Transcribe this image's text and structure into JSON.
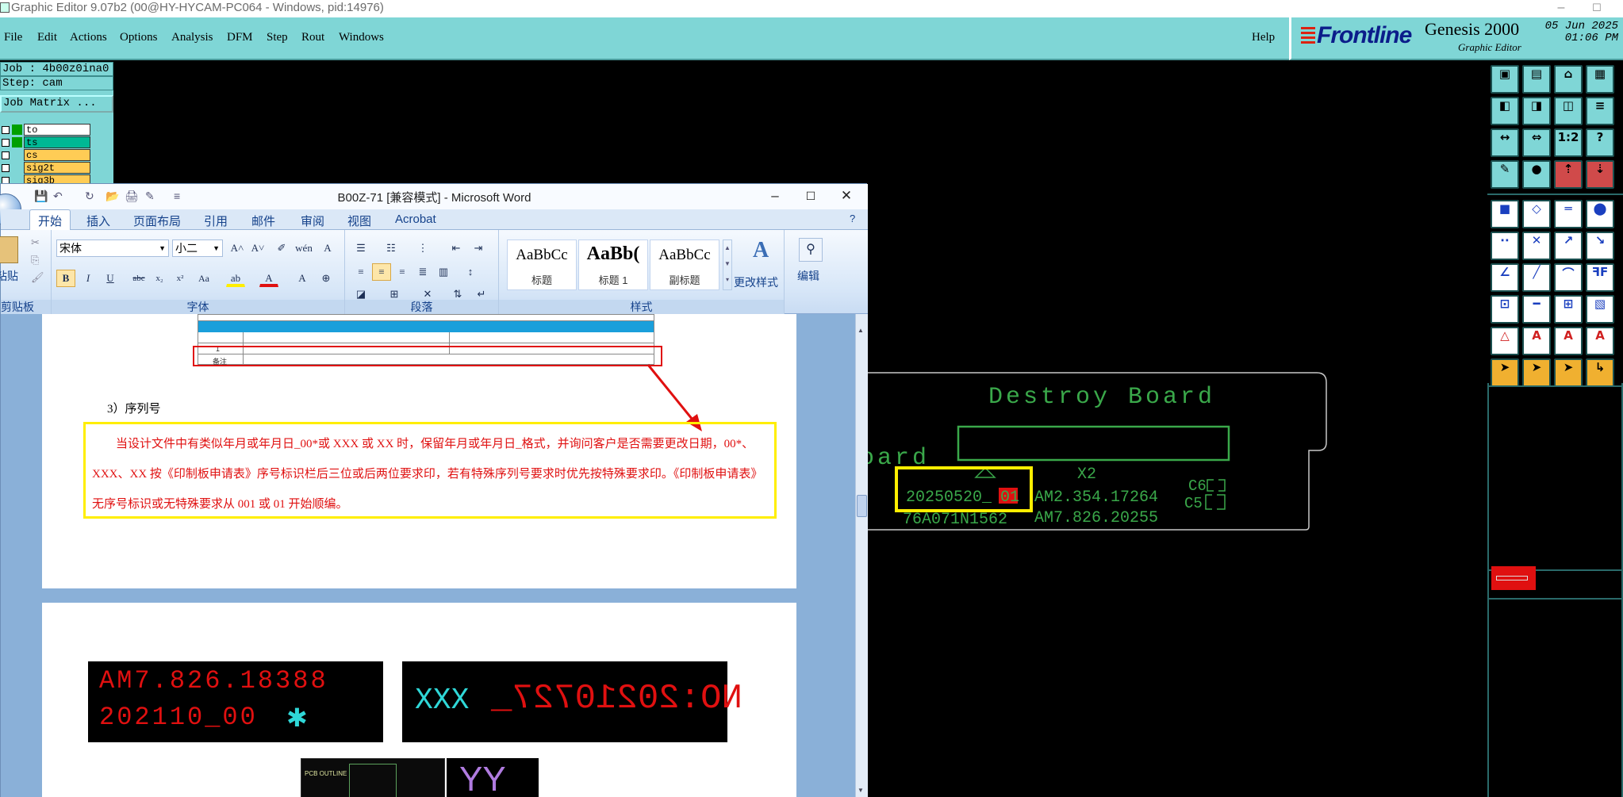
{
  "window": {
    "title": "Graphic Editor 9.07b2 (00@HY-HYCAM-PC064 - Windows, pid:14976)",
    "controls": [
      "–",
      "☐",
      "✕"
    ]
  },
  "menu": {
    "items": [
      "File",
      "Edit",
      "Actions",
      "Options",
      "Analysis",
      "DFM",
      "Step",
      "Rout",
      "Windows"
    ],
    "help": "Help"
  },
  "brand": {
    "logo": "Frontline",
    "product": "Genesis 2000",
    "subtitle": "Graphic Editor",
    "date": "05 Jun 2025",
    "time": "01:06 PM"
  },
  "job_panel": {
    "job": "Job : 4b00z0ina0",
    "step": "Step: cam",
    "matrix_button": "Job Matrix ...",
    "layers": [
      {
        "name": "to",
        "swatch": "#00a000",
        "bg": "#ffffff"
      },
      {
        "name": "ts",
        "swatch": "#00a000",
        "bg": "#00b894"
      },
      {
        "name": "cs",
        "swatch": "#7fd6d6",
        "bg": "#ffcc55"
      },
      {
        "name": "sig2t",
        "swatch": "#7fd6d6",
        "bg": "#ffcc55"
      },
      {
        "name": "sig3b",
        "swatch": "#7fd6d6",
        "bg": "#ffcc55"
      }
    ]
  },
  "canvas": {
    "board_label": "Destroy Board",
    "side_text": "oard",
    "date_code": "20250520_",
    "date_code_highlight": "01",
    "x2": "X2",
    "am_line1": "AM2.354.17264",
    "am_line2": "AM7.826.20255",
    "part_no": "76A071N1562",
    "c6": "C6",
    "c5": "C5",
    "colors": {
      "line": "#c8c8c8",
      "text": "#3aa84a",
      "highlight": "#ffee00",
      "accent": "#e01010"
    }
  },
  "word": {
    "caption": "B00Z-71 [兼容模式] - Microsoft Word",
    "controls": [
      "–",
      "☐",
      "✕"
    ],
    "tabs": [
      "开始",
      "插入",
      "页面布局",
      "引用",
      "邮件",
      "审阅",
      "视图",
      "Acrobat"
    ],
    "ribbon": {
      "paste": "粘贴",
      "clipboard_group": "剪贴板",
      "font_name": "宋体",
      "font_size": "小二",
      "font_group": "字体",
      "paragraph_group": "段落",
      "styles": [
        {
          "sample": "AaBbCc",
          "label": "标题"
        },
        {
          "sample": "AaBb(",
          "label": "标题 1"
        },
        {
          "sample": "AaBbCc",
          "label": "副标题"
        }
      ],
      "change_styles": "更改样式",
      "styles_group": "样式",
      "edit": "编辑"
    },
    "doc": {
      "section_heading": "3）序列号",
      "paragraph": "当设计文件中有类似年月或年月日_00*或 XXX 或 XX 时，保留年月或年月日_格式，并询问客户是否需要更改日期，00*、 XXX、XX 按《印制板申请表》序号标识栏后三位或后两位要求印，若有特殊序列号要求时优先按特殊要求印。《印制板申请表》无序号标识或无特殊要求从 001 或 01 开始顺编。",
      "table_row_num": "1",
      "table_row_note": "备注",
      "img1_line1": "AM7.826.18388",
      "img1_line2": "202110_00",
      "img1_star": "✱",
      "img2_xxx": "XXX",
      "img2_mirror": "NO:20210727_",
      "img3_label": "PCB OUTLINE",
      "img4_text": "YY"
    }
  }
}
